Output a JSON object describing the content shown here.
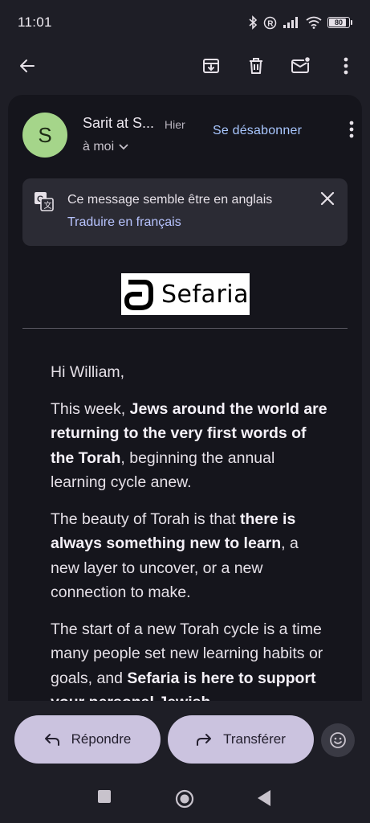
{
  "status_bar": {
    "time": "11:01",
    "battery": "80",
    "icons": [
      "bluetooth-icon",
      "registered-icon",
      "signal-icon",
      "wifi-icon",
      "battery-icon"
    ]
  },
  "toolbar": {
    "icons": [
      "back-arrow-icon",
      "archive-icon",
      "delete-icon",
      "mark-unread-icon",
      "more-vert-icon"
    ]
  },
  "email": {
    "avatar_letter": "S",
    "avatar_color": "#a5d58a",
    "sender": "Sarit at S...",
    "date": "Hier",
    "recipient": "à moi",
    "unsubscribe": "Se désabonner"
  },
  "translate": {
    "message": "Ce message semble être en anglais",
    "link": "Traduire en français"
  },
  "logo": {
    "text": "Sefaria"
  },
  "body": {
    "greeting": "Hi William,",
    "p1_a": "This week, ",
    "p1_b": "Jews around the world are returning to the very first words of the Torah",
    "p1_c": ", beginning the annual learning cycle anew.",
    "p2_a": "The beauty of Torah is that ",
    "p2_b": "there is always something new to learn",
    "p2_c": ", a new layer to uncover, or a new connection to make.",
    "p3_a": "The start of a new Torah cycle is a time many people set new learning habits or goals, and ",
    "p3_b": "Sefaria is here to support your personal Jewish"
  },
  "actions": {
    "reply": "Répondre",
    "forward": "Transférer"
  },
  "colors": {
    "background": "#1e1e26",
    "card": "#15151c",
    "accent_link": "#a9c7ff",
    "pill": "#cbc3df"
  }
}
